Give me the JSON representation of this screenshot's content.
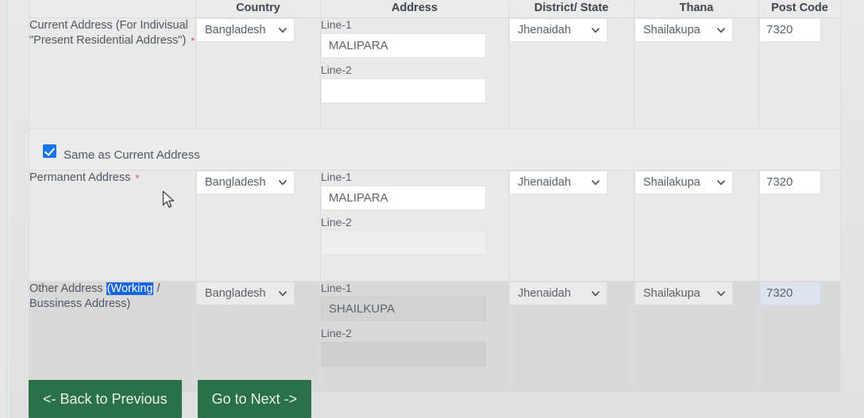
{
  "table": {
    "headers": [
      "",
      "Country",
      "Address",
      "District/ State",
      "Thana",
      "Post Code"
    ],
    "rows": [
      {
        "label_text": "Current Address (For Indivisual \"Present Residential Address\")",
        "required_mark": "*",
        "country": "Bangladesh",
        "line1_label": "Line-1",
        "line1_value": "MALIPARA",
        "line2_label": "Line-2",
        "line2_value": "",
        "district": "Jhenaidah",
        "thana": "Shailakupa",
        "post_code": "7320"
      },
      {
        "label_text": "Permanent Address",
        "required_mark": "*",
        "country": "Bangladesh",
        "line1_label": "Line-1",
        "line1_value": "MALIPARA",
        "line2_label": "Line-2",
        "line2_value": "",
        "district": "Jhenaidah",
        "thana": "Shailakupa",
        "post_code": "7320"
      },
      {
        "label_prefix": "Other Address ",
        "label_highlight": "(Working",
        "label_suffix": " / Bussiness Address)",
        "country": "Bangladesh",
        "line1_label": "Line-1",
        "line1_value": "SHAILKUPA",
        "line2_label": "Line-2",
        "line2_value": "",
        "district": "Jhenaidah",
        "thana": "Shailakupa",
        "post_code": "7320"
      }
    ]
  },
  "same_as_current": {
    "label": "Same as Current Address",
    "checked": true,
    "checkbox_color": "#1a73e8"
  },
  "footer": {
    "back_label": "<- Back to Previous",
    "next_label": "Go to Next ->",
    "button_color": "#2a7049"
  },
  "colors": {
    "required_star": "#e04b4b",
    "selection_highlight": "#1a66e0",
    "focused_field": "#dfe3ee"
  }
}
